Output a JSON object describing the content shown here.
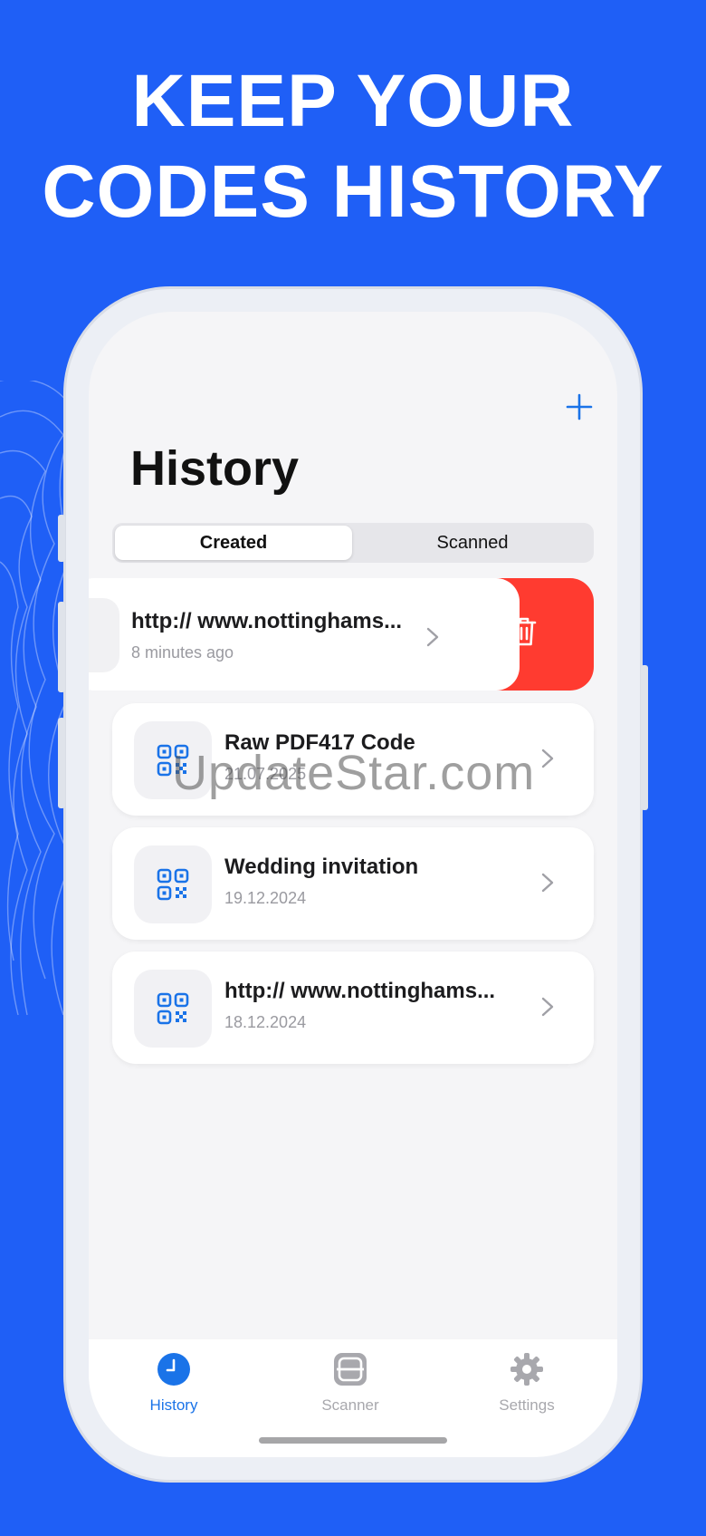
{
  "headline": {
    "line1": "KEEP YOUR",
    "line2": "CODES HISTORY"
  },
  "screen": {
    "add_icon": "plus-icon",
    "title": "History",
    "segments": {
      "created": "Created",
      "scanned": "Scanned",
      "selected": "Created"
    },
    "swiped_item": {
      "title": "http:// www.nottinghams...",
      "subtitle": "8 minutes ago",
      "action_icon": "trash-icon"
    },
    "items": [
      {
        "title": "Raw PDF417 Code",
        "subtitle": "21.07.2025",
        "icon": "qr-code-icon"
      },
      {
        "title": "Wedding invitation",
        "subtitle": "19.12.2024",
        "icon": "qr-code-icon"
      },
      {
        "title": "http:// www.nottinghams...",
        "subtitle": "18.12.2024",
        "icon": "qr-code-icon"
      }
    ],
    "watermark": "UpdateStar.com",
    "tabbar": {
      "history": "History",
      "scanner": "Scanner",
      "settings": "Settings",
      "active": "History"
    }
  },
  "colors": {
    "background": "#1f5ff6",
    "accent": "#1a73e8",
    "delete": "#ff3b30",
    "inactive": "#a8a8ad"
  }
}
